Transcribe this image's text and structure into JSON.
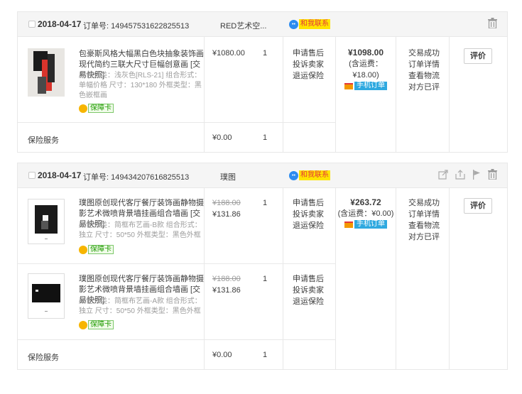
{
  "common": {
    "order_no_label": "订单号:",
    "contact_label": "和我联系",
    "protect_card": "保障卡",
    "mobile_order": "手机订单",
    "rate_button": "评价",
    "service_label": "保险服务",
    "service_price": "¥0.00",
    "service_qty": "1",
    "after_sales": [
      "申请售后",
      "投诉卖家",
      "退运保险"
    ],
    "status_links": [
      "交易成功",
      "订单详情",
      "查看物流",
      "对方已评"
    ]
  },
  "orders": [
    {
      "date": "2018-04-17",
      "order_no": "149457531622825513",
      "shop": "RED艺术空...",
      "total": "¥1098.00",
      "shipping": "(含运费：¥18.00)",
      "items": [
        {
          "title": "包豪斯风格大幅黑白色块抽象装饰画现代简约三联大尺寸巨幅创意画 [交易快照]",
          "sku": "颜色分类：浅灰色[RLS-21]  组合形式：单幅价格  尺寸：130*180  外框类型：黑色嵌框画",
          "price_old": "",
          "price": "¥1080.00",
          "qty": "1"
        }
      ]
    },
    {
      "date": "2018-04-17",
      "order_no": "149434207616825513",
      "shop": "璞图",
      "total": "¥263.72",
      "shipping": "(含运费：¥0.00)",
      "items": [
        {
          "title": "璞图原创现代客厅餐厅装饰画静物摄影艺术微喷背景墙挂画组合墙画 [交易快照]",
          "sku": "颜色分类：简框布艺画-B款  组合形式：独立  尺寸：50*50  外框类型：黑色外框",
          "price_old": "¥188.00",
          "price": "¥131.86",
          "qty": "1"
        },
        {
          "title": "璞图原创现代客厅餐厅装饰画静物摄影艺术微喷背景墙挂画组合墙画 [交易快照]",
          "sku": "颜色分类：简框布艺画-A款  组合形式：独立  尺寸：50*50  外框类型：黑色外框",
          "price_old": "¥188.00",
          "price": "¥131.86",
          "qty": "1"
        }
      ]
    }
  ],
  "icons": [
    "trash-icon",
    "share-icon",
    "upload-icon",
    "flag-icon"
  ]
}
